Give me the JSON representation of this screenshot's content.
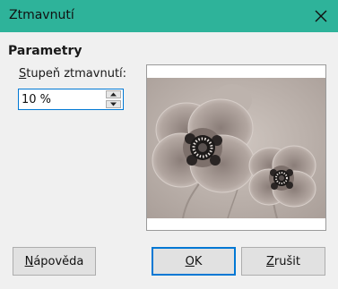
{
  "window": {
    "title": "Ztmavnutí",
    "close_icon": "close-icon"
  },
  "section": {
    "title": "Parametry"
  },
  "field": {
    "label_mnemonic": "S",
    "label_rest": "tupeň ztmavnutí:",
    "value": "10 %"
  },
  "buttons": {
    "help_mnemonic": "N",
    "help_rest": "ápověda",
    "ok_mnemonic": "O",
    "ok_rest": "K",
    "cancel_mnemonic": "Z",
    "cancel_rest": "rušit"
  },
  "colors": {
    "titlebar": "#2eb39a",
    "focus_accent": "#0078d4",
    "dialog_bg": "#f0f0f0"
  }
}
